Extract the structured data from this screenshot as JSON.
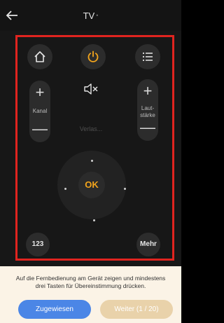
{
  "header": {
    "title": "TV",
    "title_suffix": "•"
  },
  "remote": {
    "channel_label": "Kanal",
    "volume_label_line1": "Laut-",
    "volume_label_line2": "stärke",
    "plus_symbol": "+",
    "minus_symbol": "—",
    "faded_label": "Verlas...",
    "ok_label": "OK",
    "numeric_label": "123",
    "more_label": "Mehr"
  },
  "footer": {
    "hint_line1": "Auf die Fernbedienung am Gerät zeigen und mindestens",
    "hint_line2": "drei Tasten für Übereinstimmung drücken.",
    "assigned_button": "Zugewiesen",
    "next_button": "Weiter (1 / 20)"
  },
  "colors": {
    "accent_power": "#f3a51c",
    "assigned_button": "#4b86e6",
    "next_button_disabled": "#e9d2aa",
    "highlight_frame": "#e0241f"
  },
  "icons": [
    "back-arrow-icon",
    "home-icon",
    "power-icon",
    "menu-list-icon",
    "mute-icon"
  ]
}
